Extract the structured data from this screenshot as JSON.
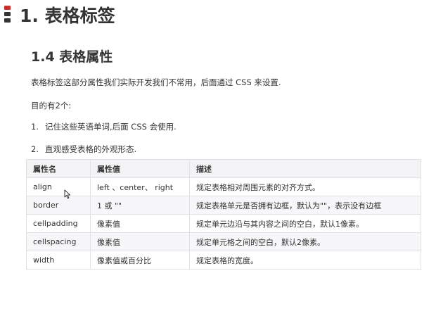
{
  "h1": {
    "title": "1. 表格标签"
  },
  "h2": {
    "title": "1.4 表格属性"
  },
  "paragraphs": [
    "表格标签这部分属性我们实际开发我们不常用，后面通过 CSS 来设置.",
    "目的有2个:"
  ],
  "list": [
    {
      "num": "1.",
      "text": "记住这些英语单词,后面 CSS 会使用."
    },
    {
      "num": "2.",
      "text": "直观感受表格的外观形态."
    }
  ],
  "table": {
    "headers": [
      "属性名",
      "属性值",
      "描述"
    ],
    "rows": [
      [
        "align",
        "left 、center、 right",
        "规定表格相对周围元素的对齐方式。"
      ],
      [
        "border",
        "1 或 \"\"",
        "规定表格单元是否拥有边框，默认为\"\"，表示没有边框"
      ],
      [
        "cellpadding",
        "像素值",
        "规定单元边沿与其内容之间的空白，默认1像素。"
      ],
      [
        "cellspacing",
        "像素值",
        "规定单元格之间的空白，默认2像素。"
      ],
      [
        "width",
        "像素值或百分比",
        "规定表格的宽度。"
      ]
    ]
  },
  "colors": {
    "marker_accent": "#c9302c",
    "text": "#333333",
    "table_header_bg": "#f3f3f5"
  },
  "icons": {
    "heading_marker": "heading-marker-icon",
    "cursor": "mouse-cursor-icon"
  }
}
